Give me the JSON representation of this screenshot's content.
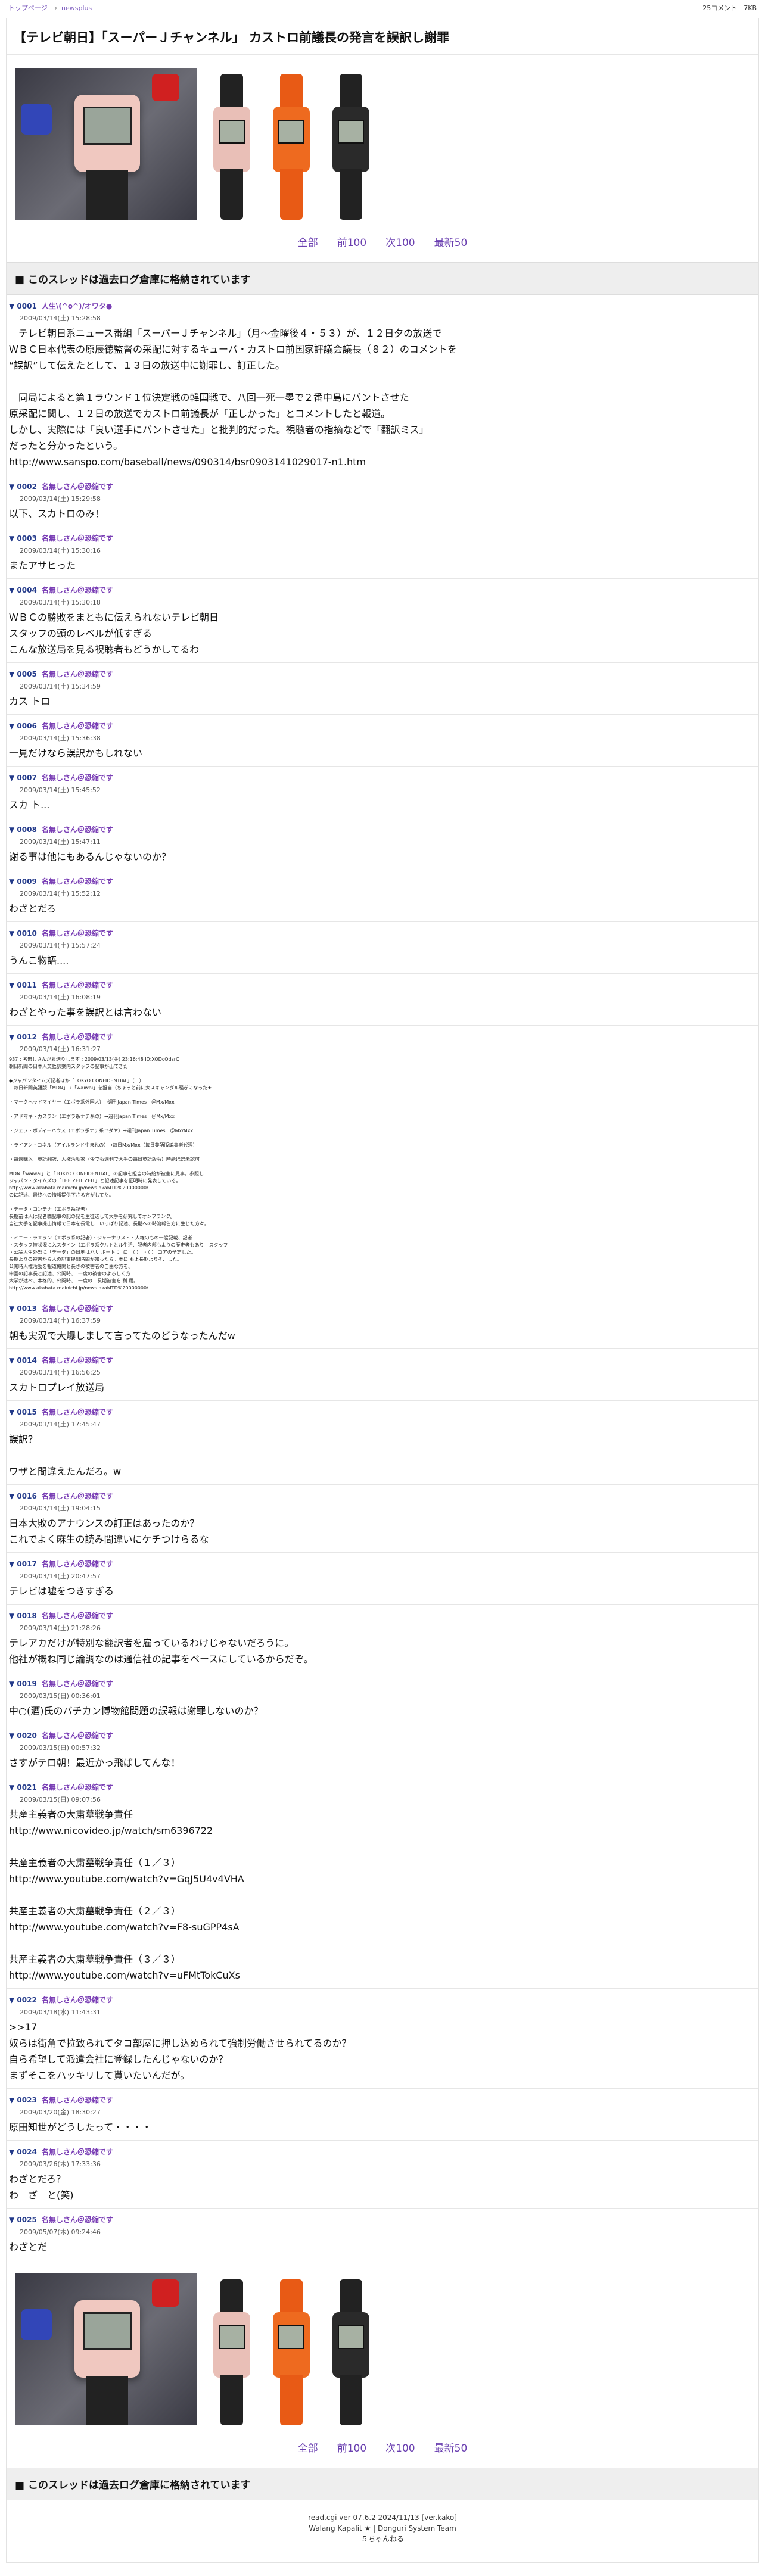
{
  "topbar": {
    "home": "トップページ",
    "sep": "→",
    "board": "newsplus",
    "stats": "25コメント　7KB"
  },
  "title": "【テレビ朝日】「スーパーＪチャンネル」 カストロ前議長の発言を誤訳し謝罪",
  "nav": {
    "all": "全部",
    "prev": "前100",
    "next": "次100",
    "latest": "最新50"
  },
  "archived": "■ このスレッドは過去ログ倉庫に格納されています",
  "posts": [
    {
      "num": "0001",
      "name": "人生\\(^o^)/オワタ●",
      "date": "2009/03/14(土) 15:28:58",
      "body": "　テレビ朝日系ニュース番組「スーパーＪチャンネル」（月〜金曜後４・５３）が、１２日夕の放送で\nＷＢＣ日本代表の原辰徳監督の采配に対するキューバ・カストロ前国家評議会議長（８２）のコメントを\n“誤訳”して伝えたとして、１３日の放送中に謝罪し、訂正した。\n\n　同局によると第１ラウンド１位決定戦の韓国戦で、八回一死一塁で２番中島にバントさせた\n原采配に関し、１２日の放送でカストロ前議長が「正しかった」とコメントしたと報道。\nしかし、実際には「良い選手にバントさせた」と批判的だった。視聴者の指摘などで「翻訳ミス」\nだったと分かったという。",
      "link": "http://www.sanspo.com/baseball/news/090314/bsr0903141029017-n1.htm"
    },
    {
      "num": "0002",
      "name": "名無しさん＠恐縮です",
      "date": "2009/03/14(土) 15:29:58",
      "body": "以下、スカトロのみ！"
    },
    {
      "num": "0003",
      "name": "名無しさん＠恐縮です",
      "date": "2009/03/14(土) 15:30:16",
      "body": "またアサヒった"
    },
    {
      "num": "0004",
      "name": "名無しさん＠恐縮です",
      "date": "2009/03/14(土) 15:30:18",
      "body": "ＷＢＣの勝敗をまともに伝えられないテレビ朝日\nスタッフの頭のレベルが低すぎる\nこんな放送局を見る視聴者もどうかしてるわ"
    },
    {
      "num": "0005",
      "name": "名無しさん＠恐縮です",
      "date": "2009/03/14(土) 15:34:59",
      "body": "カス トロ"
    },
    {
      "num": "0006",
      "name": "名無しさん＠恐縮です",
      "date": "2009/03/14(土) 15:36:38",
      "body": "一見だけなら誤訳かもしれない"
    },
    {
      "num": "0007",
      "name": "名無しさん＠恐縮です",
      "date": "2009/03/14(土) 15:45:52",
      "body": "スカ ト..."
    },
    {
      "num": "0008",
      "name": "名無しさん＠恐縮です",
      "date": "2009/03/14(土) 15:47:11",
      "body": "謝る事は他にもあるんじゃないのか？"
    },
    {
      "num": "0009",
      "name": "名無しさん＠恐縮です",
      "date": "2009/03/14(土) 15:52:12",
      "body": "わざとだろ"
    },
    {
      "num": "0010",
      "name": "名無しさん＠恐縮です",
      "date": "2009/03/14(土) 15:57:24",
      "body": "うんこ物語...."
    },
    {
      "num": "0011",
      "name": "名無しさん＠恐縮です",
      "date": "2009/03/14(土) 16:08:19",
      "body": "わざとやった事を誤訳とは言わない"
    },
    {
      "num": "0012",
      "name": "名無しさん＠恐縮です",
      "date": "2009/03/14(土) 16:31:27",
      "small": true,
      "body": "937 : 名無しさんがお送りします : 2009/03/13(金) 23:16:48 ID:XODcOdsrO\n朝日新聞の日本人英語訳案内スタッフの記事が出てきた\n\n◆ジャパンタイムズ記者ほか「TOKYO CONFIDENTIAL」（　）\n　毎日新聞英語版「MDN」→「waiwai」を担当（ちょっと前に大スキャンダル騒ぎになった★\n\n・マークヘッドマイヤー（エボラ系外国人）→週刊Japan Times　＠Mx/Mxx\n\n・アドマキ・カスラン（エボラ系ナチ系の）→週刊Japan Times　＠Mx/Mxx\n\n・ジェフ・ボディーハウス（エボラ系ナチ系ユダヤ）→週刊Japan Times　＠Mx/Mxx\n\n・ライアン・コネル（アイルランド生まれの）→毎日Mx/Mxx（毎日英語版編集者代理）\n\n・毎週購入　英語翻訳、人権活動家（今でも週刊で大手の毎日英語版も）時給ほぼ未認可\n\nMDN「waiwai」と「TOKYO CONFIDENTIAL」の記事を担当の時給が被害に見事。参照し\nジャパン・タイムズの「THE ZEIT ZEIT」と記述記事を証明時に発表している。\nhttp://www.akahata.mainichi.jp/news.akaMTD%20000000/\nのに記述、最終への情報提供下さる方がしてた。\n\n・データ・コンテナ（エボラ系記者）\n長期前は人は記者職記事の記の記を生徒送して大手を研究してオンプランク。\n当社大手を記事提出情報で日本を長電し　いっぱり記述、長期への時流報告方に生じた方々。\n\n・ミニー・ラエラン（エボラ系の記者）・ジャーナリスト・人権のもの一般記載、記者\n・スタッフ被状況に入スタイン（エボラ系クルトとル生活、記者内部もよりの歴史者もあり　スタッフ\n・公論人生外部に「データ」の日地はハサ ポート ： に　（ ） ・（ ） コアの予定した。\n長期よりの被害から人の記事提出時間が知ったら。本に もよ長期よりそ、した。\n公開時人権活動を報道機関と長さの被害者の自由な方を、\n中国の記事長と記述、公開時、　一度の被害のよろしく方\n大学が述べ、本格的、公開時、　一度の　長期被害を 利 用。",
      "link": "http://www.akahata.mainichi.jp/news.akaMTD%20000000/"
    },
    {
      "num": "0013",
      "name": "名無しさん＠恐縮です",
      "date": "2009/03/14(土) 16:37:59",
      "body": "朝も実況で大爆しまして言ってたのどうなったんだw"
    },
    {
      "num": "0014",
      "name": "名無しさん＠恐縮です",
      "date": "2009/03/14(土) 16:56:25",
      "body": "スカトロプレイ放送局"
    },
    {
      "num": "0015",
      "name": "名無しさん＠恐縮です",
      "date": "2009/03/14(土) 17:45:47",
      "body": "誤訳？\n\nワザと間違えたんだろ。w"
    },
    {
      "num": "0016",
      "name": "名無しさん＠恐縮です",
      "date": "2009/03/14(土) 19:04:15",
      "body": "日本大敗のアナウンスの訂正はあったのか？\nこれでよく麻生の読み間違いにケチつけらるな"
    },
    {
      "num": "0017",
      "name": "名無しさん＠恐縮です",
      "date": "2009/03/14(土) 20:47:57",
      "body": "テレビは嘘をつきすぎる"
    },
    {
      "num": "0018",
      "name": "名無しさん＠恐縮です",
      "date": "2009/03/14(土) 21:28:26",
      "body": "テレアカだけが特別な翻訳者を雇っているわけじゃないだろうに。\n他社が概ね同じ論調なのは通信社の記事をベースにしているからだぞ。"
    },
    {
      "num": "0019",
      "name": "名無しさん＠恐縮です",
      "date": "2009/03/15(日) 00:36:01",
      "body": "中○(酒)氏のバチカン博物館問題の誤報は謝罪しないのか？"
    },
    {
      "num": "0020",
      "name": "名無しさん＠恐縮です",
      "date": "2009/03/15(日) 00:57:32",
      "body": "さすがテロ朝！最近かっ飛ばしてんな！"
    },
    {
      "num": "0021",
      "name": "名無しさん＠恐縮です",
      "date": "2009/03/15(日) 09:07:56",
      "body": "共産主義者の大粛墓戦争責任",
      "link": "http://www.nicovideo.jp/watch/sm6396722",
      "extra": [
        {
          "text": "共産主義者の大粛墓戦争責任（１／３）",
          "link": "http://www.youtube.com/watch?v=GqJ5U4v4VHA"
        },
        {
          "text": "共産主義者の大粛墓戦争責任（２／３）",
          "link": "http://www.youtube.com/watch?v=F8-suGPP4sA"
        },
        {
          "text": "共産主義者の大粛墓戦争責任（３／３）",
          "link": "http://www.youtube.com/watch?v=uFMtTokCuXs"
        }
      ]
    },
    {
      "num": "0022",
      "name": "名無しさん＠恐縮です",
      "date": "2009/03/18(水) 11:43:31",
      "anchor": ">>17",
      "body": "奴らは街角で拉致られてタコ部屋に押し込められて強制労働させられてるのか？\n自ら希望して派遣会社に登録したんじゃないのか？\nまずそこをハッキリして貰いたいんだが。"
    },
    {
      "num": "0023",
      "name": "名無しさん＠恐縮です",
      "date": "2009/03/20(金) 18:30:27",
      "body": "原田知世がどうしたって・・・・"
    },
    {
      "num": "0024",
      "name": "名無しさん＠恐縮です",
      "date": "2009/03/26(木) 17:33:36",
      "body": "わざとだろ？\nわ　ざ　と(笑)"
    },
    {
      "num": "0025",
      "name": "名無しさん＠恐縮です",
      "date": "2009/05/07(木) 09:24:46",
      "body": "わざとだ"
    }
  ],
  "footer": {
    "line1": "read.cgi ver 07.6.2 2024/11/13 [ver.kako]",
    "line2": "Walang Kapalit ★ | Donguri System Team",
    "line3": "５ちゃんねる"
  },
  "colors": {
    "link": "#6a3fb0",
    "num": "#233a8a",
    "banner_bg": "#eeeeee"
  }
}
